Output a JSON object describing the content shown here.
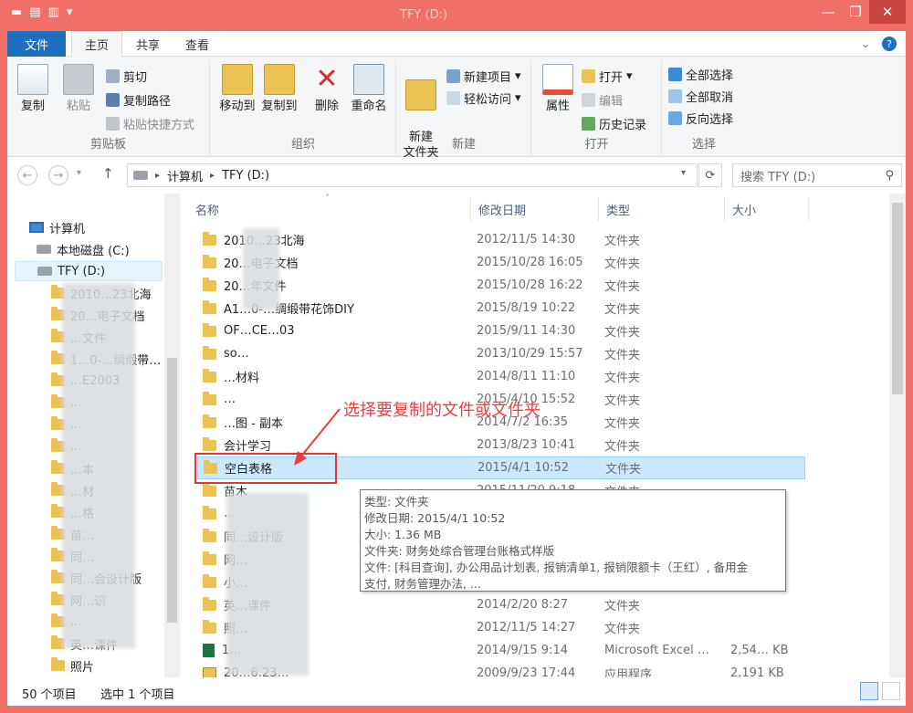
{
  "window": {
    "title": "TFY (D:)",
    "minimize": "—",
    "maximize": "❐",
    "close": "✕"
  },
  "tabs": {
    "file": "文件",
    "home": "主页",
    "share": "共享",
    "view": "查看"
  },
  "ribbon": {
    "clipboard": {
      "label": "剪贴板",
      "copy": "复制",
      "paste": "粘贴",
      "cut": "剪切",
      "copy_path": "复制路径",
      "paste_shortcut": "粘贴快捷方式"
    },
    "organize": {
      "label": "组织",
      "move_to": "移动到",
      "copy_to": "复制到",
      "delete": "删除",
      "rename": "重命名"
    },
    "new": {
      "label": "新建",
      "new_folder": "新建\n文件夹",
      "new_item": "新建项目",
      "easy_access": "轻松访问"
    },
    "open": {
      "label": "打开",
      "properties": "属性",
      "open": "打开",
      "edit": "编辑",
      "history": "历史记录"
    },
    "select": {
      "label": "选择",
      "select_all": "全部选择",
      "select_none": "全部取消",
      "invert": "反向选择"
    }
  },
  "address": {
    "path_1": "计算机",
    "path_2": "TFY (D:)",
    "separator": "▸",
    "search_placeholder": "搜索 TFY (D:)"
  },
  "nav": {
    "computer": "计算机",
    "local_disk": "本地磁盘 (C:)",
    "tfy": "TFY (D:)",
    "items": [
      "2010…23北海",
      "20…电子文档",
      "…文件",
      "1…0-…绸缎带…",
      "…E2003",
      "…",
      "…",
      "…",
      "…本",
      "…材",
      "…格",
      "苗…",
      "同…",
      "同…会设计版",
      "网…识",
      "…",
      "英…课件",
      "照片"
    ]
  },
  "columns": {
    "name": "名称",
    "modified": "修改日期",
    "type": "类型",
    "size": "大小"
  },
  "files": [
    {
      "name": "2010…23北海",
      "date": "2012/11/5 14:30",
      "type": "文件夹",
      "size": ""
    },
    {
      "name": "20…电子文档",
      "date": "2015/10/28 16:05",
      "type": "文件夹",
      "size": ""
    },
    {
      "name": "20…年文件",
      "date": "2015/10/28 16:22",
      "type": "文件夹",
      "size": ""
    },
    {
      "name": "A1…0-…绸缎带花饰DIY",
      "date": "2015/8/19 10:22",
      "type": "文件夹",
      "size": ""
    },
    {
      "name": "OF…CE…03",
      "date": "2015/9/11 14:30",
      "type": "文件夹",
      "size": ""
    },
    {
      "name": "so…",
      "date": "2013/10/29 15:57",
      "type": "文件夹",
      "size": ""
    },
    {
      "name": "…材料",
      "date": "2014/8/11 11:10",
      "type": "文件夹",
      "size": ""
    },
    {
      "name": "…",
      "date": "2015/4/10 15:52",
      "type": "文件夹",
      "size": ""
    },
    {
      "name": "…图 - 副本",
      "date": "2014/7/2 16:35",
      "type": "文件夹",
      "size": ""
    },
    {
      "name": "会计学习",
      "date": "2013/8/23 10:41",
      "type": "文件夹",
      "size": ""
    },
    {
      "name": "空白表格",
      "date": "2015/4/1 10:52",
      "type": "文件夹",
      "size": ""
    },
    {
      "name": "苗木",
      "date": "2015/11/20 9:18",
      "type": "文件夹",
      "size": ""
    },
    {
      "name": "…",
      "date": "",
      "type": "",
      "size": ""
    },
    {
      "name": "同…设计版",
      "date": "",
      "type": "",
      "size": ""
    },
    {
      "name": "网…",
      "date": "",
      "type": "",
      "size": ""
    },
    {
      "name": "小…",
      "date": "",
      "type": "",
      "size": ""
    },
    {
      "name": "英…课件",
      "date": "2014/2/20 8:27",
      "type": "文件夹",
      "size": ""
    },
    {
      "name": "照…",
      "date": "2012/11/5 14:27",
      "type": "文件夹",
      "size": ""
    },
    {
      "name": "1…",
      "date": "2014/9/15 9:14",
      "type": "Microsoft Excel …",
      "size": "2,54… KB"
    },
    {
      "name": "20…6.23…",
      "date": "2009/9/23 17:44",
      "type": "应用程序",
      "size": "2,191 KB"
    }
  ],
  "tooltip": {
    "line1": "类型: 文件夹",
    "line2": "修改日期: 2015/4/1 10:52",
    "line3": "大小: 1.36 MB",
    "line4": "文件夹: 财务处综合管理台账格式样版",
    "line5": "文件: [科目查询], 办公用品计划表, 报销清单1, 报销限额卡（王红）, 备用金",
    "line6": "支付, 财务管理办法, ..."
  },
  "annotation": "选择要复制的文件或文件夹",
  "status": {
    "count": "50 个项目",
    "selected": "选中 1 个项目"
  },
  "colors": {
    "title_bar": "#f07068",
    "file_tab": "#1e6fbf",
    "selection": "#cce8ff",
    "annotation": "#ef3b3b"
  }
}
